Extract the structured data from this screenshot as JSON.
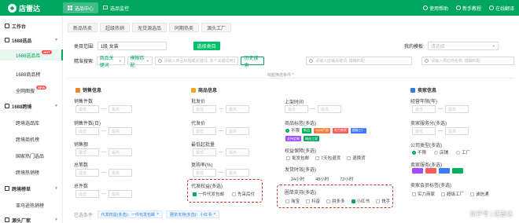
{
  "topbar": {
    "logo_text": "店雷达",
    "nav": [
      {
        "label": "选品中心"
      },
      {
        "label": "选品监控"
      }
    ],
    "links": [
      {
        "label": "使用帮助"
      },
      {
        "label": "新手教程"
      },
      {
        "label": "在线翻译"
      }
    ]
  },
  "sidebar": {
    "items": [
      {
        "type": "head",
        "label": "工作台"
      },
      {
        "type": "head",
        "label": "1688选品"
      },
      {
        "type": "sub",
        "label": "1688选品库",
        "active": true,
        "badge": "HOT"
      },
      {
        "type": "sub",
        "label": "1688商品榜"
      },
      {
        "type": "sub",
        "label": "全网图搜",
        "badge": "NEW"
      },
      {
        "type": "head",
        "label": "1688跨境"
      },
      {
        "type": "sub",
        "label": "跨境选品库"
      },
      {
        "type": "sub",
        "label": "跨境商机榜"
      },
      {
        "type": "sub",
        "label": "国家热门选品"
      },
      {
        "type": "sub",
        "label": "跨境热销榜"
      },
      {
        "type": "head",
        "label": "跨境榜单"
      },
      {
        "type": "sub",
        "label": "亚马逊热销榜"
      },
      {
        "type": "head",
        "label": "源头厂家"
      }
    ]
  },
  "tabs": [
    "新品热卖",
    "超级热销",
    "无货源选品",
    "同期热卖",
    "源头工厂"
  ],
  "filters": {
    "category_label": "类目范围:",
    "category_value": "1级  女装",
    "category_button": "选择类目",
    "mine_label": "我的模板:",
    "mine_placeholder": "请选择",
    "search_label": "精准搜索:",
    "search_select": "商品关键词",
    "match_select": "模糊匹配",
    "search_placeholder": "请输入商品标题或关键词, 多个关键词用逗号隔开",
    "history_button": "历史搜索",
    "shop_placeholder": "请输入店铺关键词, 模糊匹配",
    "factory_placeholder": "请输入供应商名称, 模糊匹配",
    "expand_text": "收起筛选条件 ^"
  },
  "sections": {
    "sales": {
      "title": "销售信息",
      "color": "#f5822a",
      "fields": [
        "销售件数",
        "销售件数(日)",
        "销售额",
        "总笔数",
        "总件数"
      ]
    },
    "product": {
      "title": "商品信息",
      "color": "#f5a623",
      "fields": [
        "批发价",
        "代发价",
        "最低起批量",
        "复购率(%)"
      ],
      "proxy_label": "代发权益(多选)",
      "proxy_options": [
        {
          "label": "一件代发包邮",
          "checked": true
        },
        {
          "label": "先采后付",
          "checked": false
        }
      ]
    },
    "middle": {
      "listing_label": "上架时间",
      "product_tags_label": "商品标签(多选)",
      "rights_label": "权益保障(多选)",
      "rights_options": [
        "批发包邮",
        "7天包退货",
        "退换货"
      ],
      "ship_label": "发货时效(多选)",
      "ship_options": [
        "24小时",
        "48小时",
        "72小时"
      ],
      "channel_label": "圈单支持(多选)",
      "channel_options": [
        {
          "label": "淘宝",
          "checked": false
        },
        {
          "label": "抖音",
          "checked": false
        },
        {
          "label": "拼多多",
          "checked": false
        },
        {
          "label": "小红书",
          "checked": true
        },
        {
          "label": "快手",
          "checked": false
        }
      ],
      "tag_not_limited": "不限",
      "tag_pills": [
        {
          "label": "新品",
          "color": "#00b25c"
        },
        {
          "label": "1688严选",
          "color": "#ff7a3d"
        },
        {
          "label": "实力商家",
          "color": "#ff5a5a"
        },
        {
          "label": "超级工厂",
          "color": "#3d7cff"
        },
        {
          "label": "支持定制",
          "color": "#a14dff"
        },
        {
          "label": "精选之星",
          "color": "#00a660"
        }
      ]
    },
    "shop": {
      "title": "卖家信息",
      "color": "#2f7de1",
      "years_label": "经营年限(年)",
      "score_label": "卖家服务分(多选)",
      "company_label": "公司类型(多选)",
      "company_options": [
        "不限",
        "店铺",
        "工厂"
      ],
      "service_label": "卖家服务(多选)",
      "member_label": "卖家会员标签(多选)",
      "member_options": [
        "实力商家",
        "超级工厂",
        "诚信通"
      ]
    }
  },
  "range_placeholder": "最低",
  "range_placeholder_max": "最高",
  "applied": {
    "label": "已选条件:",
    "tags": [
      "代发权益(多选)：一件代发包邮",
      "圈单支持(多选)：小红书"
    ]
  },
  "watermark": "知乎号 | 店雷达"
}
